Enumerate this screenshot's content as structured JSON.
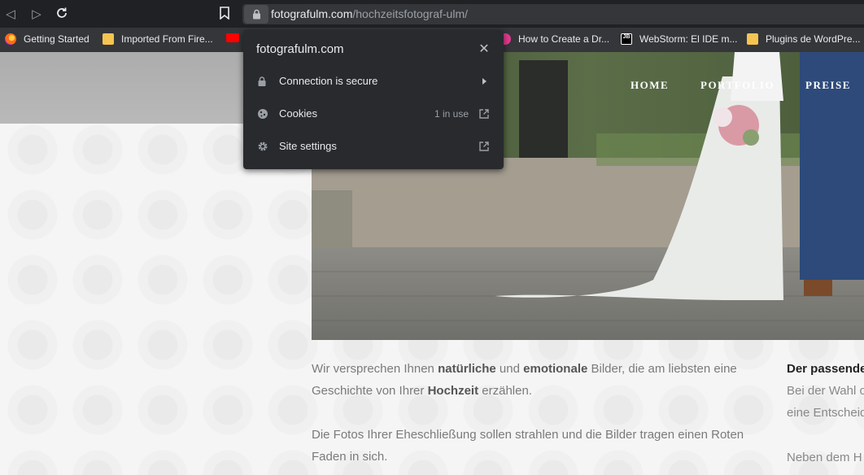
{
  "toolbar": {
    "url_domain": "fotografulm.com",
    "url_path": "/hochzeitsfotograf-ulm/",
    "back_icon": "back-arrow-icon",
    "forward_icon": "forward-arrow-icon",
    "reload_icon": "reload-icon",
    "bookmark_icon": "bookmark-icon"
  },
  "bookmarks": [
    {
      "label": "Getting Started",
      "icon": "firefox-icon"
    },
    {
      "label": "Imported From Fire...",
      "icon": "folder-icon"
    },
    {
      "label": "How to Create a Dr...",
      "icon": "site-icon"
    },
    {
      "label": "WebStorm: El IDE m...",
      "icon": "jetbrains-icon"
    },
    {
      "label": "Plugins de WordPre...",
      "icon": "folder-icon"
    }
  ],
  "site_nav": [
    "HOME",
    "PORTFOLIO",
    "PREISE"
  ],
  "content": {
    "p1_a": "Wir versprechen  Ihnen ",
    "p1_b": "natürliche",
    "p1_c": " und ",
    "p1_d": "emotionale",
    "p1_e": " Bilder, die am liebsten eine Geschichte von Ihrer ",
    "p1_f": "Hochzeit",
    "p1_g": " erzählen.",
    "p2": "Die Fotos Ihrer Eheschließung sollen strahlen und die Bilder tragen einen Roten Faden in sich.",
    "side_title": "Der passende",
    "side_l1": "Bei der Wahl o",
    "side_l2": "eine Entscheid",
    "side_l3": "Neben dem H"
  },
  "site_info_popup": {
    "title": "fotografulm.com",
    "rows": [
      {
        "label": "Connection is secure",
        "icon": "lock-icon",
        "note": ""
      },
      {
        "label": "Cookies",
        "icon": "cookie-icon",
        "note": "1 in use"
      },
      {
        "label": "Site settings",
        "icon": "gear-icon",
        "note": ""
      }
    ]
  },
  "colors": {
    "toolbar_bg": "#202124",
    "popup_bg": "#292a2d",
    "accent_text": "#e8eaed"
  }
}
